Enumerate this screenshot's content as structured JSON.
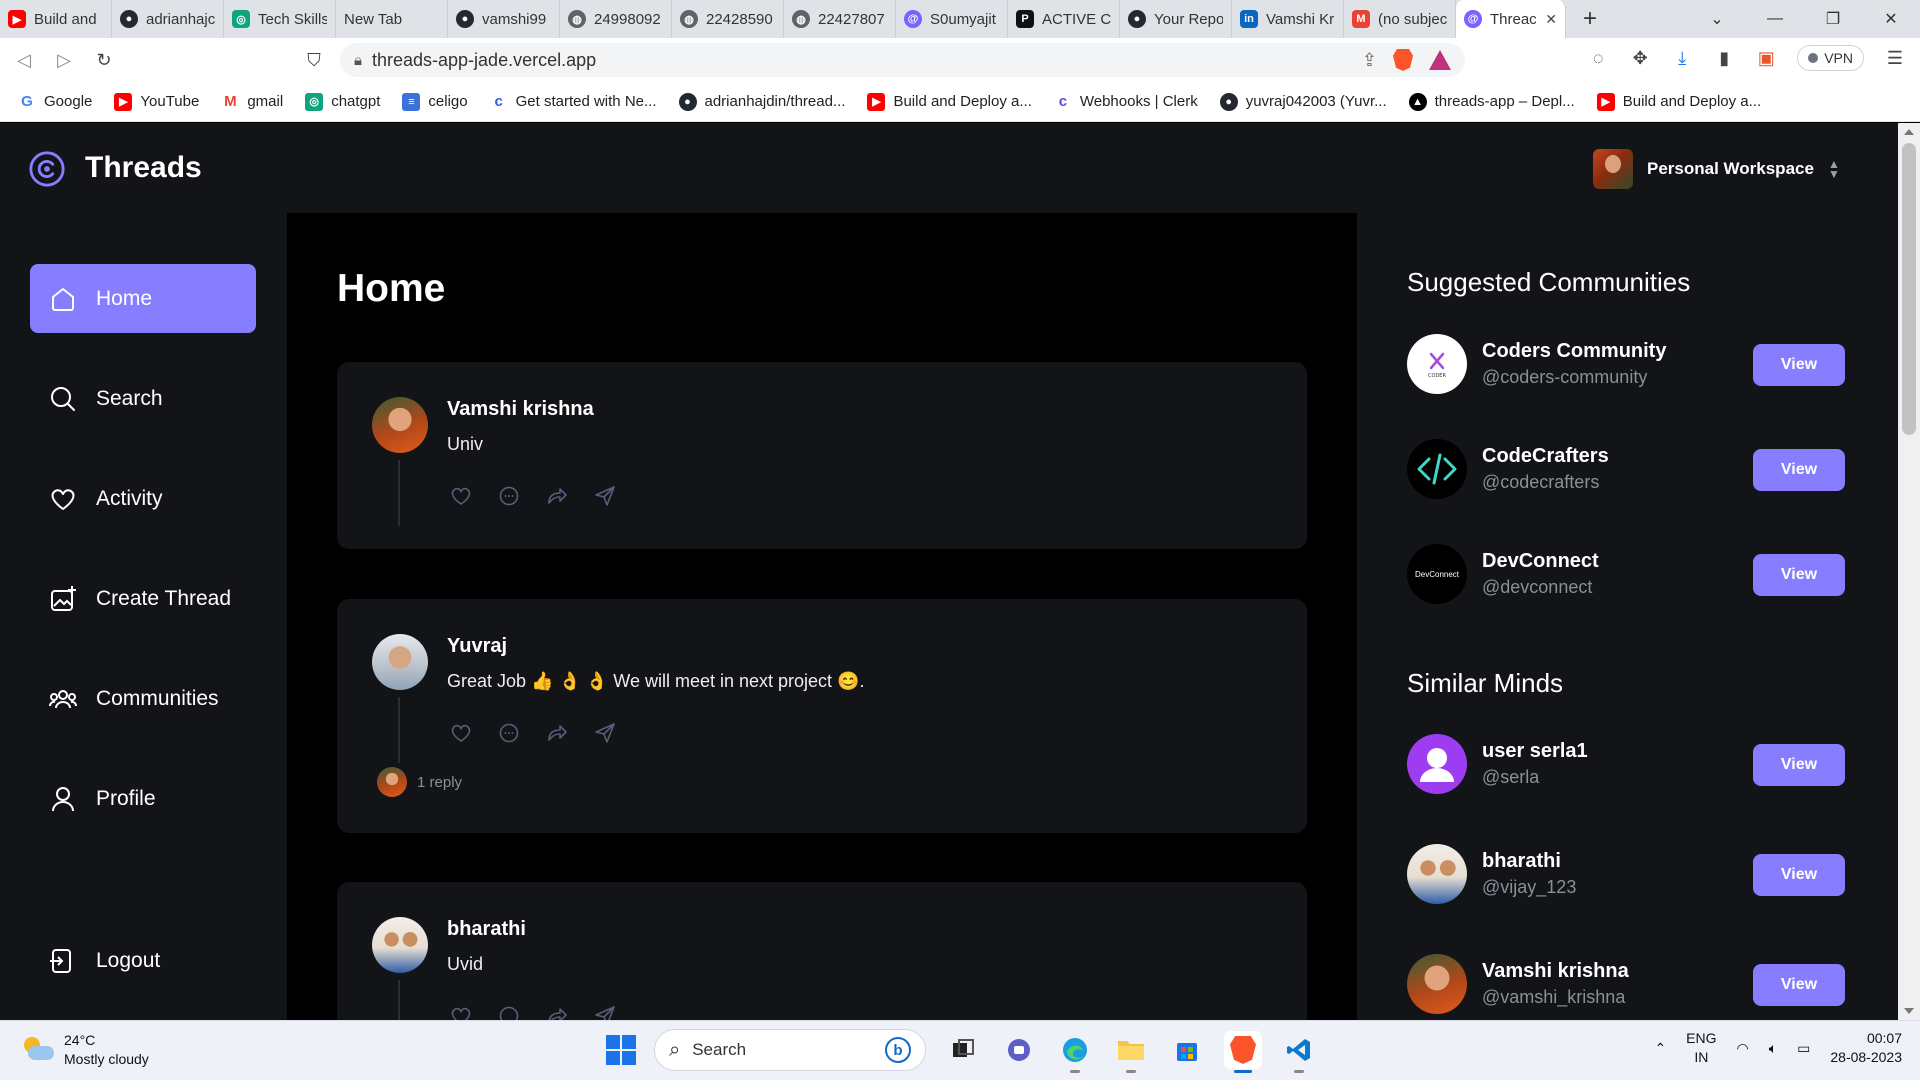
{
  "browser": {
    "tabs": [
      {
        "label": "Build and",
        "icon": "youtube-icon",
        "color": "#ff0000"
      },
      {
        "label": "adrianhajc",
        "icon": "github-icon",
        "color": "#24292f"
      },
      {
        "label": "Tech Skills",
        "icon": "chatgpt-icon",
        "color": "#10a37f"
      },
      {
        "label": "New Tab",
        "icon": "",
        "color": ""
      },
      {
        "label": "vamshi99",
        "icon": "github-icon",
        "color": "#24292f"
      },
      {
        "label": "24998092",
        "icon": "globe-icon",
        "color": "#5f6368"
      },
      {
        "label": "22428590",
        "icon": "globe-icon",
        "color": "#5f6368"
      },
      {
        "label": "22427807",
        "icon": "globe-icon",
        "color": "#5f6368"
      },
      {
        "label": "S0umyajit",
        "icon": "threads-icon",
        "color": "#7b61ff"
      },
      {
        "label": "ACTIVE CC",
        "icon": "p-icon",
        "color": "#111111"
      },
      {
        "label": "Your Repo",
        "icon": "github-icon",
        "color": "#24292f"
      },
      {
        "label": "Vamshi Kr",
        "icon": "linkedin-icon",
        "color": "#0a66c2"
      },
      {
        "label": "(no subjec",
        "icon": "gmail-icon",
        "color": "#ea4335"
      }
    ],
    "active_tab": {
      "label": "Threac",
      "close": "✕"
    },
    "new_tab": "+",
    "window_controls": {
      "dropdown": "⌄",
      "minimize": "—",
      "maximize": "❐",
      "close": "✕"
    },
    "url": "threads-app-jade.vercel.app",
    "vpn_label": "VPN",
    "bookmarks": [
      {
        "label": "Google",
        "icon": "google-icon",
        "color": "#4285f4",
        "glyph": "G"
      },
      {
        "label": "YouTube",
        "icon": "youtube-icon",
        "color": "#ff0000",
        "glyph": "▶"
      },
      {
        "label": "gmail",
        "icon": "gmail-icon",
        "color": "#ea4335",
        "glyph": "M"
      },
      {
        "label": "chatgpt",
        "icon": "chatgpt-icon",
        "color": "#10a37f",
        "glyph": "◎"
      },
      {
        "label": "celigo",
        "icon": "doc-icon",
        "color": "#3b73d9",
        "glyph": "≡"
      },
      {
        "label": "Get started with Ne...",
        "icon": "celigo-icon",
        "color": "#3b5bdb",
        "glyph": "c"
      },
      {
        "label": "adrianhajdin/thread...",
        "icon": "github-icon",
        "color": "#24292f",
        "glyph": "●"
      },
      {
        "label": "Build and Deploy a...",
        "icon": "youtube-icon",
        "color": "#ff0000",
        "glyph": "▶"
      },
      {
        "label": "Webhooks | Clerk",
        "icon": "clerk-icon",
        "color": "#5b4bdb",
        "glyph": "c"
      },
      {
        "label": "yuvraj042003 (Yuvr...",
        "icon": "github-icon",
        "color": "#24292f",
        "glyph": "●"
      },
      {
        "label": "threads-app – Depl...",
        "icon": "vercel-icon",
        "color": "#000000",
        "glyph": "▲"
      },
      {
        "label": "Build and Deploy a...",
        "icon": "youtube-icon",
        "color": "#ff0000",
        "glyph": "▶"
      }
    ]
  },
  "app": {
    "brand": "Threads",
    "workspace": "Personal Workspace",
    "accent": "#877eff",
    "nav": [
      {
        "label": "Home",
        "icon": "home-icon",
        "active": true
      },
      {
        "label": "Search",
        "icon": "search-icon",
        "active": false
      },
      {
        "label": "Activity",
        "icon": "heart-icon",
        "active": false
      },
      {
        "label": "Create Thread",
        "icon": "create-thread-icon",
        "active": false
      },
      {
        "label": "Communities",
        "icon": "communities-icon",
        "active": false
      },
      {
        "label": "Profile",
        "icon": "user-icon",
        "active": false
      }
    ],
    "logout": "Logout",
    "page_title": "Home",
    "threads": [
      {
        "author": "Vamshi krishna",
        "content": "Univ",
        "avatar": "vamshi"
      },
      {
        "author": "Yuvraj",
        "content": "Great Job 👍 👌 👌 We will meet in next project 😊.",
        "avatar": "yuvraj",
        "reply_text": "1 reply"
      },
      {
        "author": "bharathi",
        "content": "Uvid",
        "avatar": "bharathi"
      }
    ],
    "suggested_communities_title": "Suggested Communities",
    "suggested_communities": [
      {
        "name": "Coders Community",
        "handle": "@coders-community",
        "button": "View",
        "logo_text": "CODER"
      },
      {
        "name": "CodeCrafters",
        "handle": "@codecrafters",
        "button": "View",
        "logo_text": "</>"
      },
      {
        "name": "DevConnect",
        "handle": "@devconnect",
        "button": "View",
        "logo_text": "DevConnect"
      }
    ],
    "similar_minds_title": "Similar Minds",
    "similar_minds": [
      {
        "name": "user serla1",
        "handle": "@serla",
        "button": "View"
      },
      {
        "name": "bharathi",
        "handle": "@vijay_123",
        "button": "View"
      },
      {
        "name": "Vamshi krishna",
        "handle": "@vamshi_krishna",
        "button": "View"
      }
    ]
  },
  "taskbar": {
    "temperature": "24°C",
    "weather": "Mostly cloudy",
    "search_placeholder": "Search",
    "lang_1": "ENG",
    "lang_2": "IN",
    "time": "00:07",
    "date": "28-08-2023"
  }
}
